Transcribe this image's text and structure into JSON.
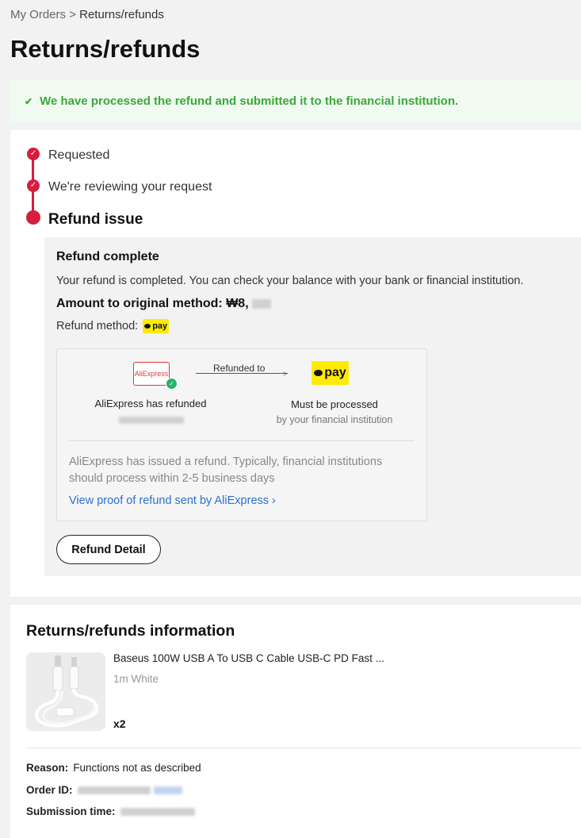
{
  "breadcrumb": {
    "parent": "My Orders",
    "separator": ">",
    "current": "Returns/refunds"
  },
  "page_title": "Returns/refunds",
  "banner": {
    "icon": "check-icon",
    "message": "We have processed the refund and submitted it to the financial institution.",
    "color": "#3aa83a"
  },
  "timeline": {
    "accent": "#d71d3e",
    "steps": [
      {
        "label": "Requested",
        "state": "done"
      },
      {
        "label": "We're reviewing your request",
        "state": "done"
      },
      {
        "label": "Refund issue",
        "state": "current"
      }
    ]
  },
  "refund": {
    "title": "Refund complete",
    "description": "Your refund is completed. You can check your balance with your bank or financial institution.",
    "amount_label": "Amount to original method:",
    "amount_visible": "₩8,",
    "method_label": "Refund method:",
    "method_badge": "pay",
    "flow": {
      "source_logo": "AliExpress",
      "arrow_label": "Refunded to",
      "target_badge": "pay",
      "left_title": "AliExpress has refunded",
      "right_title": "Must be processed",
      "right_subtitle": "by your financial institution",
      "note": "AliExpress has issued a refund. Typically, financial institutions should process within 2-5 business days",
      "proof_link": "View proof of refund sent by AliExpress ›"
    },
    "detail_button": "Refund Detail"
  },
  "info": {
    "title": "Returns/refunds information",
    "product": {
      "name": "Baseus 100W USB A To USB C Cable USB-C PD Fast ...",
      "variant": "1m White",
      "quantity": "x2"
    },
    "reason_label": "Reason:",
    "reason_value": "Functions not as described",
    "order_id_label": "Order ID:",
    "submission_label": "Submission time:"
  }
}
